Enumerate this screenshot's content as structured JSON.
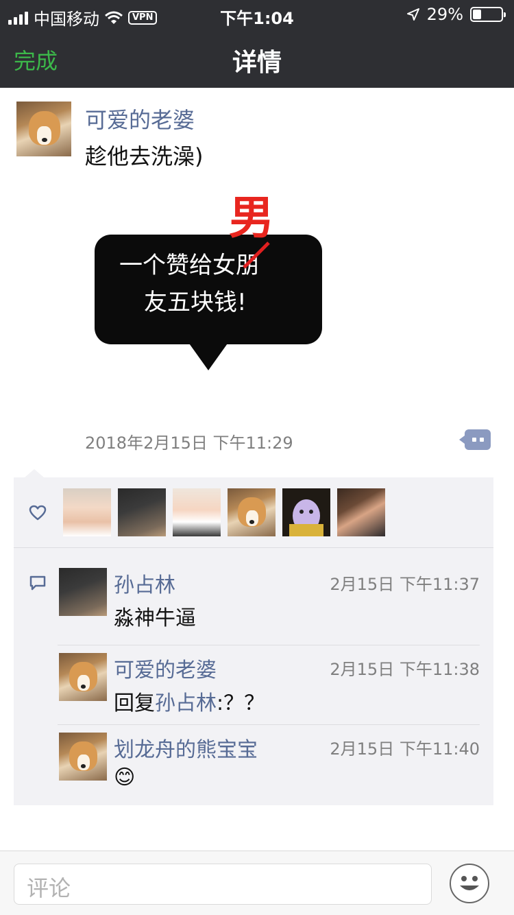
{
  "status_bar": {
    "carrier": "中国移动",
    "vpn": "VPN",
    "time": "下午1:04",
    "battery": "29%",
    "battery_level": 0.29
  },
  "nav": {
    "done_label": "完成",
    "title": "详情"
  },
  "post": {
    "author": "可爱的老婆",
    "text": "趁他去洗澡)",
    "sticker": {
      "line1": "一个赞给女朋",
      "line2": "友五块钱!",
      "correction": "男"
    },
    "time": "2018年2月15日 下午11:29"
  },
  "likes": {
    "icon": "heart-icon",
    "avatars": [
      "kid1",
      "kid2",
      "kid3",
      "corgi",
      "cartoon",
      "man"
    ]
  },
  "comments": [
    {
      "name": "孙占林",
      "time": "2月15日 下午11:37",
      "text": "淼神牛逼",
      "avatar": "kid2"
    },
    {
      "name": "可爱的老婆",
      "time": "2月15日 下午11:38",
      "reply_prefix": "回复",
      "reply_to": "孙占林",
      "text": ":？？",
      "avatar": "corgi"
    },
    {
      "name": "划龙舟的熊宝宝",
      "time": "2月15日 下午11:40",
      "text": "😊",
      "avatar": "corgi"
    }
  ],
  "input": {
    "placeholder": "评论"
  },
  "colors": {
    "bar_bg": "#2e2f33",
    "accent_green": "#3cb84a",
    "link_blue": "#576b95"
  }
}
